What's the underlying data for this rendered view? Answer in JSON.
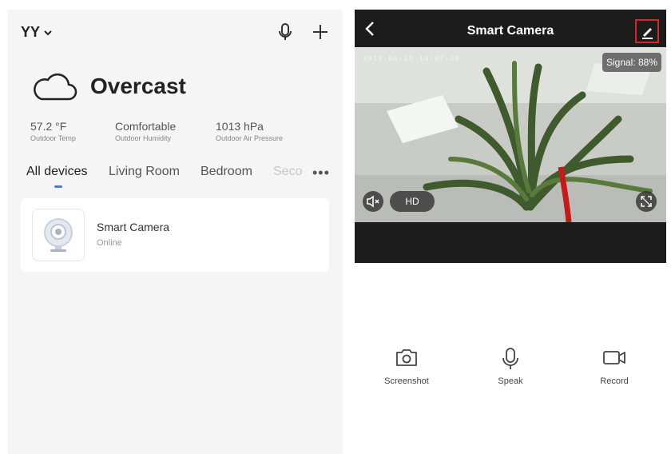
{
  "home": {
    "name": "YY",
    "weather": {
      "condition": "Overcast",
      "stats": [
        {
          "value": "57.2 °F",
          "label": "Outdoor Temp"
        },
        {
          "value": "Comfortable",
          "label": "Outdoor Humidity"
        },
        {
          "value": "1013 hPa",
          "label": "Outdoor Air Pressure"
        }
      ]
    },
    "tabs": [
      "All devices",
      "Living Room",
      "Bedroom",
      "Seco"
    ],
    "more_label": "•••",
    "device": {
      "name": "Smart Camera",
      "status": "Online"
    }
  },
  "camera": {
    "title": "Smart Camera",
    "timestamp": "2019-04-18  14:07:20",
    "signal": "Signal: 88%",
    "quality": "HD",
    "controls": [
      {
        "label": "Screenshot",
        "icon": "camera-icon"
      },
      {
        "label": "Speak",
        "icon": "microphone-icon"
      },
      {
        "label": "Record",
        "icon": "video-camera-icon"
      }
    ],
    "highlight_color": "#d9232e"
  }
}
